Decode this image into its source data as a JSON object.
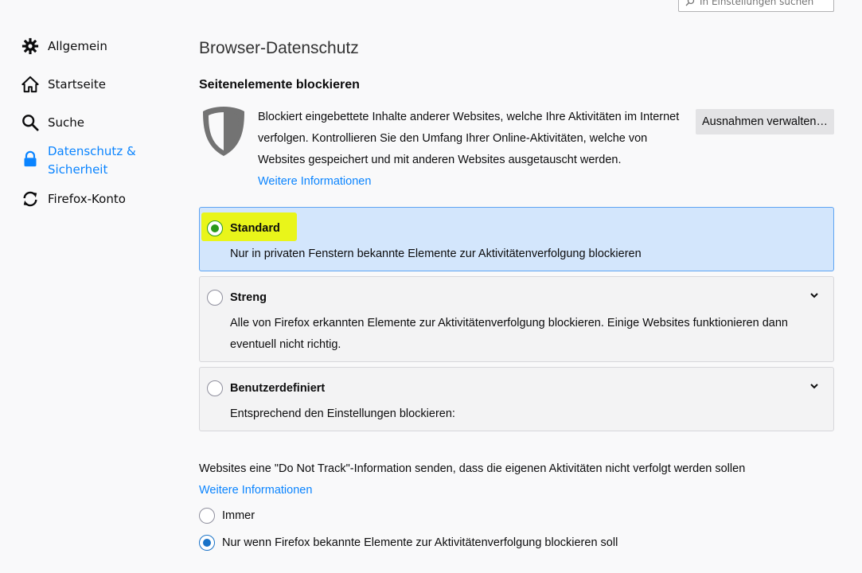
{
  "search": {
    "placeholder": "In Einstellungen suchen"
  },
  "sidebar": {
    "items": [
      {
        "label": "Allgemein",
        "icon": "gear-icon"
      },
      {
        "label": "Startseite",
        "icon": "home-icon"
      },
      {
        "label": "Suche",
        "icon": "search-icon"
      },
      {
        "label": "Datenschutz & Sicherheit",
        "icon": "lock-icon",
        "selected": true
      },
      {
        "label": "Firefox-Konto",
        "icon": "sync-icon"
      }
    ]
  },
  "main": {
    "page_title": "Browser-Datenschutz",
    "section_title": "Seitenelemente blockieren",
    "description": "Blockiert eingebettete Inhalte anderer Websites, welche Ihre Aktivitäten im Internet verfolgen. Kontrollieren Sie den Umfang Ihrer Online-Aktivitäten, welche von Websites gespeichert und mit anderen Websites ausgetauscht werden.",
    "more_info": "Weitere Informationen",
    "exceptions_button": "Ausnahmen verwalten…",
    "options": [
      {
        "label": "Standard",
        "desc": "Nur in privaten Fenstern bekannte Elemente zur Aktivitätenverfolgung blockieren",
        "checked": true
      },
      {
        "label": "Streng",
        "desc": "Alle von Firefox erkannten Elemente zur Aktivitätenverfolgung blockieren. Einige Websites funktionieren dann eventuell nicht richtig.",
        "checked": false
      },
      {
        "label": "Benutzerdefiniert",
        "desc": "Entsprechend den Einstellungen blockieren:",
        "checked": false
      }
    ],
    "dnt": {
      "text": "Websites eine \"Do Not Track\"-Information senden, dass die eigenen Aktivitäten nicht verfolgt werden sollen",
      "more_info": "Weitere Informationen",
      "options": [
        {
          "label": "Immer",
          "checked": false
        },
        {
          "label": "Nur wenn Firefox bekannte Elemente zur Aktivitätenverfolgung blockieren soll",
          "checked": true
        }
      ]
    }
  },
  "colors": {
    "accent": "#0a84ff",
    "highlight": "#e9f51a",
    "selected_card": "#d3e6fc"
  }
}
